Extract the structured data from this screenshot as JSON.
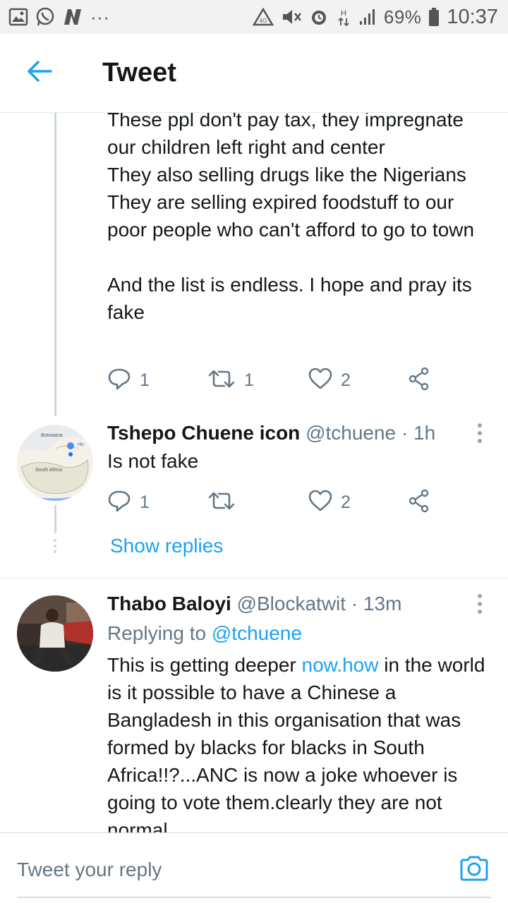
{
  "status_bar": {
    "battery": "69%",
    "time": "10:37",
    "more": "···"
  },
  "header": {
    "title": "Tweet"
  },
  "tweet_top": {
    "text": "These ppl don't pay tax, they impregnate our children left right and center\nThey also selling drugs like the Nigerians\nThey are selling expired foodstuff to our poor people who can't afford to go to town\n\nAnd the list is endless. I hope and pray its fake",
    "replies": "1",
    "retweets": "1",
    "likes": "2"
  },
  "tweet_reply1": {
    "name": "Tshepo Chuene icon",
    "handle": "@tchuene · 1h",
    "text": "Is not fake",
    "replies": "1",
    "retweets": "",
    "likes": "2",
    "avatar_map_labels": {
      "country_top": "Botswana",
      "country_main": "South Africa",
      "pin_label": "Ho"
    }
  },
  "show_replies": "Show replies",
  "tweet_reply2": {
    "name": "Thabo Baloyi",
    "handle": "@Blockatwit · 13m",
    "replying_prefix": "Replying to ",
    "replying_handle": "@tchuene",
    "text_before_link": "This is getting deeper ",
    "link_text": "now.how",
    "text_after_link": " in the world is it possible to have a Chinese a Bangladesh in this organisation that was formed by blacks for blacks in South Africa!!?...ANC is now a joke whoever is going to vote them.clearly they are not normal"
  },
  "reply_bar": {
    "placeholder": "Tweet your reply"
  },
  "colors": {
    "accent": "#1da1f2",
    "secondary_text": "#657786",
    "divider": "#e1e8ed"
  }
}
